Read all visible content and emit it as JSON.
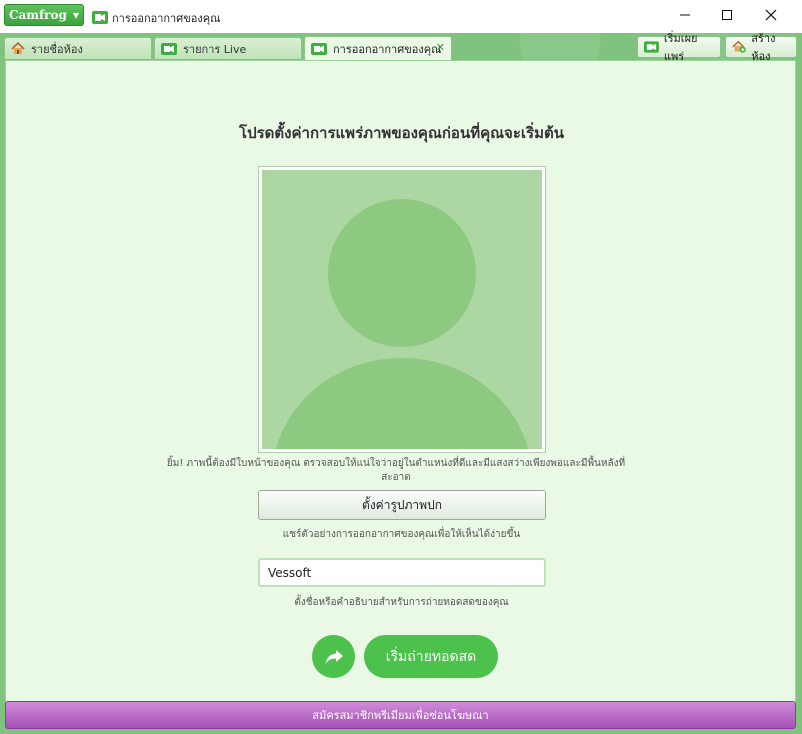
{
  "app": {
    "brand": "Camfrog",
    "window_title": "การออกอากาศของคุณ"
  },
  "tabs": [
    {
      "label": "รายชื่อห้อง",
      "icon": "home-icon",
      "active": false
    },
    {
      "label": "รายการ Live",
      "icon": "camera-icon",
      "active": false
    },
    {
      "label": "การออกอากาศของคุณ",
      "icon": "camera-icon",
      "active": true
    }
  ],
  "top_buttons": {
    "start_broadcast": "เริ่มเผยแพร่",
    "create_room": "สร้างห้อง"
  },
  "main": {
    "heading": "โปรดตั้งค่าการแพร่ภาพของคุณก่อนที่คุณจะเริ่มต้น",
    "hint_line1": "ยิ้ม! ภาพนี้ต้องมีใบหน้าของคุณ ตรวจสอบให้แน่ใจว่าอยู่ในตำแหน่งที่ดีและมีแสงสว่างเพียงพอและมีพื้นหลังที่",
    "hint_line2": "สะอาด",
    "set_avatar_button": "ตั้งค่ารูปภาพปก",
    "share_hint": "แชร์ตัวอย่างการออกอากาศของคุณเพื่อให้เห็นได้ง่ายขึ้น",
    "name_value": "Vessoft",
    "name_hint": "ตั้งชื่อหรือคำอธิบายสำหรับการถ่ายทอดสดของคุณ",
    "go_live_button": "เริ่มถ่ายทอดสด"
  },
  "promo": {
    "label": "สมัครสมาชิกพรีเมียมเพื่อซ่อนโฆษณา"
  },
  "colors": {
    "accent_green": "#4cc14c",
    "frame_green": "#7fc37f",
    "panel_bg": "#eaf8e6",
    "promo_purple": "#a552b5"
  }
}
